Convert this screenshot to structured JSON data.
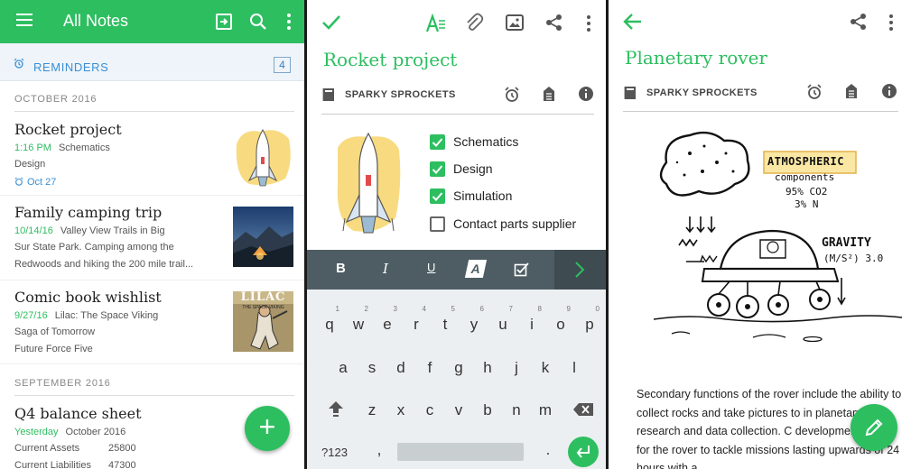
{
  "panel_all_notes": {
    "toolbar": {
      "title": "All Notes",
      "icons": [
        "menu-icon",
        "sync-icon",
        "search-icon",
        "more-vert-icon"
      ]
    },
    "reminders": {
      "label": "REMINDERS",
      "count": "4"
    },
    "sections": [
      {
        "header": "OCTOBER 2016",
        "notes": [
          {
            "title": "Rocket project",
            "date": "1:16 PM",
            "snippet": "Schematics",
            "line2": "Design",
            "line3": "",
            "reminder": "Oct 27",
            "thumb": "rocket"
          },
          {
            "title": "Family camping trip",
            "date": "10/14/16",
            "snippet": "Valley View Trails in Big",
            "line2": "Sur State Park. Camping among the",
            "line3": "Redwoods and hiking the 200 mile trail...",
            "reminder": "",
            "thumb": "campsite"
          },
          {
            "title": "Comic book wishlist",
            "date": "9/27/16",
            "snippet": "Lilac: The Space Viking",
            "line2": "Saga of Tomorrow",
            "line3": "Future Force Five",
            "reminder": "",
            "thumb": "comic",
            "thumb_text": "LILAC",
            "thumb_subtext": "THE SPACE VIKING"
          }
        ]
      },
      {
        "header": "SEPTEMBER 2016",
        "notes": [
          {
            "title": "Q4 balance sheet",
            "date": "Yesterday",
            "snippet": "October 2016",
            "line2_label": "Current Assets",
            "line2_value": "25800",
            "line3_label": "Current Liabilities",
            "line3_value": "47300"
          }
        ]
      }
    ],
    "fab_label": "+"
  },
  "panel_editor": {
    "toolbar_icons": [
      "check-icon",
      "text-format-icon",
      "attach-icon",
      "image-icon",
      "share-icon",
      "more-vert-icon"
    ],
    "note_title": "Rocket project",
    "notebook": "SPARKY SPROCKETS",
    "meta_icons": [
      "reminder-icon",
      "tag-icon",
      "info-icon"
    ],
    "checklist": [
      {
        "label": "Schematics",
        "checked": true
      },
      {
        "label": "Design",
        "checked": true
      },
      {
        "label": "Simulation",
        "checked": true
      },
      {
        "label": "Contact parts supplier",
        "checked": false
      }
    ],
    "format_bar": [
      "B",
      "I",
      "U",
      "A"
    ],
    "keyboard": {
      "row1": [
        "q",
        "w",
        "e",
        "r",
        "t",
        "y",
        "u",
        "i",
        "o",
        "p"
      ],
      "row1_hints": [
        "1",
        "2",
        "3",
        "4",
        "5",
        "6",
        "7",
        "8",
        "9",
        "0"
      ],
      "row2": [
        "a",
        "s",
        "d",
        "f",
        "g",
        "h",
        "j",
        "k",
        "l"
      ],
      "row3": [
        "z",
        "x",
        "c",
        "v",
        "b",
        "n",
        "m"
      ],
      "symbols_key": "?123",
      "comma": ",",
      "period": "."
    }
  },
  "panel_view": {
    "note_title": "Planetary rover",
    "notebook": "SPARKY SPROCKETS",
    "sketch_text": {
      "box1": "ATMOSPHERIC",
      "box2": "components",
      "line1": "95% CO2",
      "line2": "3% N",
      "gravity": "GRAVITY",
      "gravity_val": "(M/S²) 3.0"
    },
    "body": "Secondary functions of the rover include the ability to collect rocks and take pictures to in planetary research and data collection. C development allows for the rover to tackle missions lasting upwards of 24 hours with a"
  },
  "colors": {
    "brand_green": "#2dbe60",
    "reminder_blue": "#3b8fd4",
    "format_bar": "#4e5d63"
  }
}
